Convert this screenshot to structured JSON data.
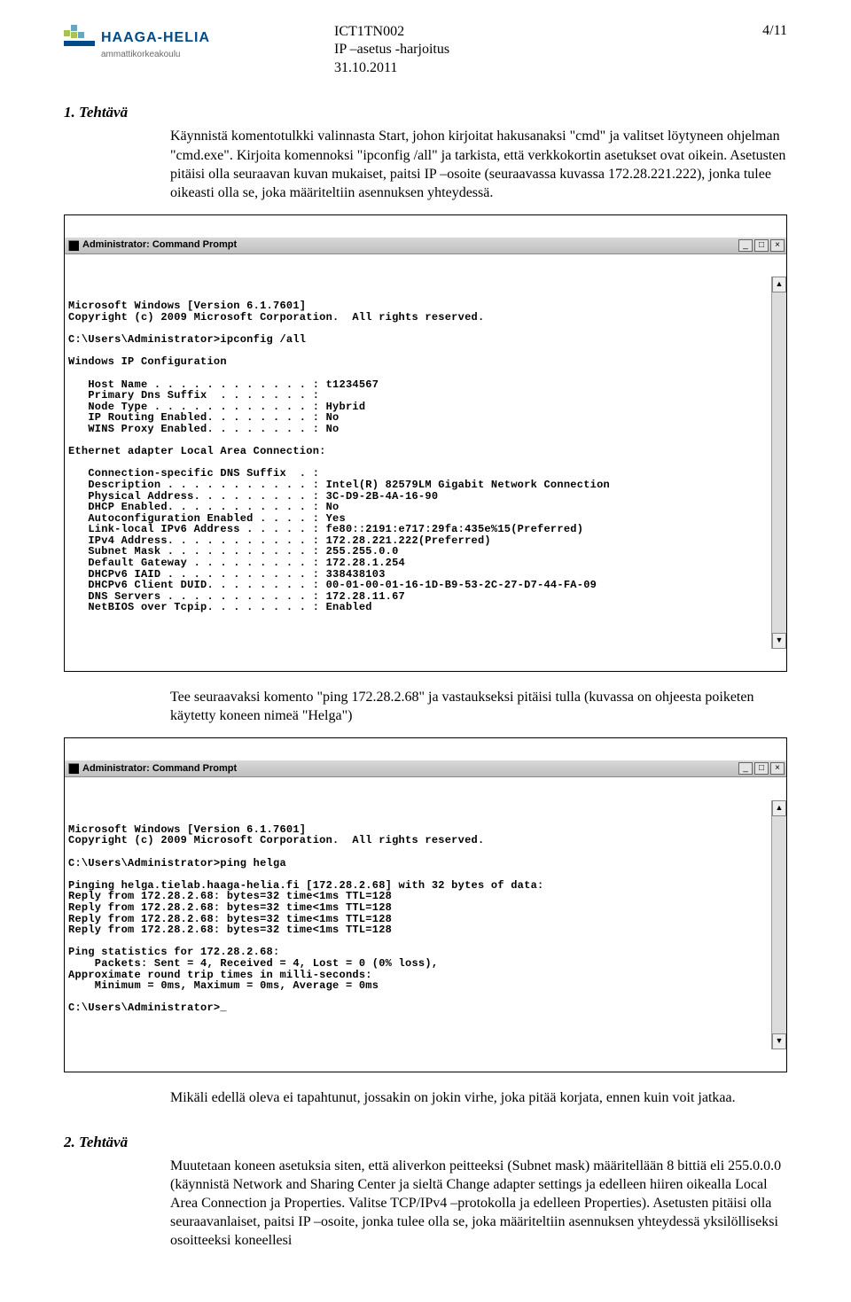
{
  "header": {
    "logo_name": "HAAGA-HELIA",
    "logo_sub": "ammattikorkeakoulu",
    "code": "ICT1TN002",
    "subtitle": "IP –asetus -harjoitus",
    "date": "31.10.2011",
    "page": "4/11"
  },
  "section1": {
    "heading": "1. Tehtävä",
    "p1": "Käynnistä komentotulkki valinnasta Start, johon kirjoitat hakusanaksi \"cmd\" ja valitset löytyneen ohjelman \"cmd.exe\". Kirjoita komennoksi \"ipconfig /all\" ja tarkista, että verkkokortin asetukset ovat oikein. Asetusten pitäisi olla seuraavan kuvan mukaiset, paitsi IP –osoite (seuraavassa kuvassa 172.28.221.222), jonka tulee oikeasti olla se, joka määriteltiin asennuksen yhteydessä.",
    "p2": "Tee seuraavaksi komento \"ping 172.28.2.68\" ja vastaukseksi pitäisi tulla (kuvassa on ohjeesta poiketen käytetty koneen nimeä \"Helga\")",
    "p3": "Mikäli edellä oleva ei tapahtunut, jossakin on jokin virhe, joka pitää korjata, ennen kuin voit jatkaa."
  },
  "section2": {
    "heading": "2. Tehtävä",
    "p1": "Muutetaan koneen asetuksia siten, että aliverkon peitteeksi (Subnet mask) määritellään 8 bittiä eli 255.0.0.0 (käynnistä Network and Sharing Center ja sieltä Change adapter settings ja edelleen hiiren oikealla Local Area Connection ja Properties. Valitse TCP/IPv4 –protokolla ja edelleen Properties). Asetusten pitäisi olla seuraavanlaiset, paitsi IP –osoite, jonka tulee olla se, joka määriteltiin asennuksen yhteydessä yksilölliseksi osoitteeksi koneellesi"
  },
  "terminal1": {
    "title": "Administrator: Command Prompt",
    "text": "Microsoft Windows [Version 6.1.7601]\nCopyright (c) 2009 Microsoft Corporation.  All rights reserved.\n\nC:\\Users\\Administrator>ipconfig /all\n\nWindows IP Configuration\n\n   Host Name . . . . . . . . . . . . : t1234567\n   Primary Dns Suffix  . . . . . . . :\n   Node Type . . . . . . . . . . . . : Hybrid\n   IP Routing Enabled. . . . . . . . : No\n   WINS Proxy Enabled. . . . . . . . : No\n\nEthernet adapter Local Area Connection:\n\n   Connection-specific DNS Suffix  . :\n   Description . . . . . . . . . . . : Intel(R) 82579LM Gigabit Network Connection\n   Physical Address. . . . . . . . . : 3C-D9-2B-4A-16-90\n   DHCP Enabled. . . . . . . . . . . : No\n   Autoconfiguration Enabled . . . . : Yes\n   Link-local IPv6 Address . . . . . : fe80::2191:e717:29fa:435e%15(Preferred)\n   IPv4 Address. . . . . . . . . . . : 172.28.221.222(Preferred)\n   Subnet Mask . . . . . . . . . . . : 255.255.0.0\n   Default Gateway . . . . . . . . . : 172.28.1.254\n   DHCPv6 IAID . . . . . . . . . . . : 338438103\n   DHCPv6 Client DUID. . . . . . . . : 00-01-00-01-16-1D-B9-53-2C-27-D7-44-FA-09\n   DNS Servers . . . . . . . . . . . : 172.28.11.67\n   NetBIOS over Tcpip. . . . . . . . : Enabled"
  },
  "terminal2": {
    "title": "Administrator: Command Prompt",
    "text": "Microsoft Windows [Version 6.1.7601]\nCopyright (c) 2009 Microsoft Corporation.  All rights reserved.\n\nC:\\Users\\Administrator>ping helga\n\nPinging helga.tielab.haaga-helia.fi [172.28.2.68] with 32 bytes of data:\nReply from 172.28.2.68: bytes=32 time<1ms TTL=128\nReply from 172.28.2.68: bytes=32 time<1ms TTL=128\nReply from 172.28.2.68: bytes=32 time<1ms TTL=128\nReply from 172.28.2.68: bytes=32 time<1ms TTL=128\n\nPing statistics for 172.28.2.68:\n    Packets: Sent = 4, Received = 4, Lost = 0 (0% loss),\nApproximate round trip times in milli-seconds:\n    Minimum = 0ms, Maximum = 0ms, Average = 0ms\n\nC:\\Users\\Administrator>_"
  },
  "win_buttons": {
    "min": "_",
    "max": "□",
    "close": "×",
    "up": "▲",
    "down": "▼"
  }
}
